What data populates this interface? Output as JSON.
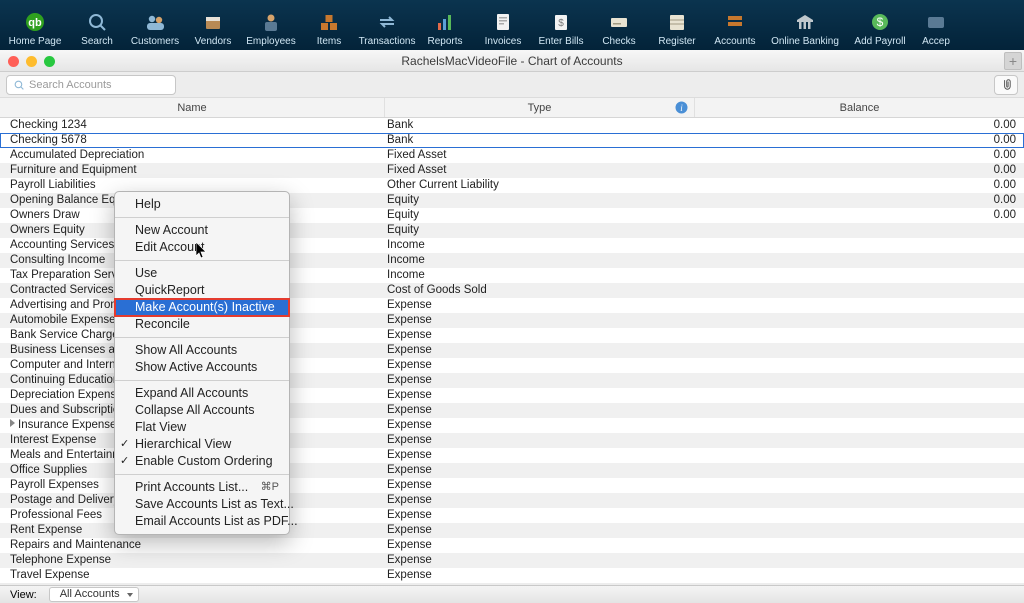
{
  "toolbar": [
    {
      "label": "Home Page",
      "icon": "qb"
    },
    {
      "label": "Search",
      "icon": "search"
    },
    {
      "label": "Customers",
      "icon": "customers"
    },
    {
      "label": "Vendors",
      "icon": "vendors"
    },
    {
      "label": "Employees",
      "icon": "employees"
    },
    {
      "label": "Items",
      "icon": "items"
    },
    {
      "label": "Transactions",
      "icon": "transactions"
    },
    {
      "label": "Reports",
      "icon": "reports"
    },
    {
      "label": "Invoices",
      "icon": "invoices"
    },
    {
      "label": "Enter Bills",
      "icon": "bills"
    },
    {
      "label": "Checks",
      "icon": "checks"
    },
    {
      "label": "Register",
      "icon": "register"
    },
    {
      "label": "Accounts",
      "icon": "accounts"
    },
    {
      "label": "Online Banking",
      "icon": "bank"
    },
    {
      "label": "Add Payroll",
      "icon": "payroll"
    },
    {
      "label": "Accep",
      "icon": "accept"
    }
  ],
  "window_title": "RachelsMacVideoFile - Chart of Accounts",
  "search_placeholder": "Search Accounts",
  "columns": {
    "name": "Name",
    "type": "Type",
    "balance": "Balance"
  },
  "accounts": [
    {
      "name": "Checking 1234",
      "type": "Bank",
      "balance": "0.00"
    },
    {
      "name": "Checking 5678",
      "type": "Bank",
      "balance": "0.00",
      "selected": true
    },
    {
      "name": "Accumulated Depreciation",
      "type": "Fixed Asset",
      "balance": "0.00"
    },
    {
      "name": "Furniture and Equipment",
      "type": "Fixed Asset",
      "balance": "0.00"
    },
    {
      "name": "Payroll Liabilities",
      "type": "Other Current Liability",
      "balance": "0.00"
    },
    {
      "name": "Opening Balance Equity",
      "type": "Equity",
      "balance": "0.00"
    },
    {
      "name": "Owners Draw",
      "type": "Equity",
      "balance": "0.00"
    },
    {
      "name": "Owners Equity",
      "type": "Equity",
      "balance": ""
    },
    {
      "name": "Accounting Services Income",
      "type": "Income",
      "balance": ""
    },
    {
      "name": "Consulting Income",
      "type": "Income",
      "balance": ""
    },
    {
      "name": "Tax Preparation Services",
      "type": "Income",
      "balance": ""
    },
    {
      "name": "Contracted Services",
      "type": "Cost of Goods Sold",
      "balance": ""
    },
    {
      "name": "Advertising and Promotion",
      "type": "Expense",
      "balance": ""
    },
    {
      "name": "Automobile Expense",
      "type": "Expense",
      "balance": ""
    },
    {
      "name": "Bank Service Charges",
      "type": "Expense",
      "balance": ""
    },
    {
      "name": "Business Licenses and Permits",
      "type": "Expense",
      "balance": ""
    },
    {
      "name": "Computer and Internet Expense",
      "type": "Expense",
      "balance": ""
    },
    {
      "name": "Continuing Education",
      "type": "Expense",
      "balance": ""
    },
    {
      "name": "Depreciation Expense",
      "type": "Expense",
      "balance": ""
    },
    {
      "name": "Dues and Subscriptions",
      "type": "Expense",
      "balance": ""
    },
    {
      "name": "Insurance Expense",
      "type": "Expense",
      "balance": "",
      "caret": true
    },
    {
      "name": "Interest Expense",
      "type": "Expense",
      "balance": ""
    },
    {
      "name": "Meals and Entertainment",
      "type": "Expense",
      "balance": ""
    },
    {
      "name": "Office Supplies",
      "type": "Expense",
      "balance": ""
    },
    {
      "name": "Payroll Expenses",
      "type": "Expense",
      "balance": ""
    },
    {
      "name": "Postage and Delivery",
      "type": "Expense",
      "balance": ""
    },
    {
      "name": "Professional Fees",
      "type": "Expense",
      "balance": ""
    },
    {
      "name": "Rent Expense",
      "type": "Expense",
      "balance": ""
    },
    {
      "name": "Repairs and Maintenance",
      "type": "Expense",
      "balance": ""
    },
    {
      "name": "Telephone Expense",
      "type": "Expense",
      "balance": ""
    },
    {
      "name": "Travel Expense",
      "type": "Expense",
      "balance": ""
    }
  ],
  "context_menu": [
    {
      "label": "Help"
    },
    {
      "sep": true
    },
    {
      "label": "New Account"
    },
    {
      "label": "Edit Account"
    },
    {
      "sep": true
    },
    {
      "label": "Use"
    },
    {
      "label": "QuickReport"
    },
    {
      "label": "Make Account(s) Inactive",
      "highlight": true,
      "redbox": true
    },
    {
      "label": "Reconcile"
    },
    {
      "sep": true
    },
    {
      "label": "Show All Accounts"
    },
    {
      "label": "Show Active Accounts"
    },
    {
      "sep": true
    },
    {
      "label": "Expand All Accounts"
    },
    {
      "label": "Collapse All Accounts"
    },
    {
      "label": "Flat View"
    },
    {
      "label": "Hierarchical View",
      "check": true
    },
    {
      "label": "Enable Custom Ordering",
      "check": true
    },
    {
      "sep": true
    },
    {
      "label": "Print Accounts List...",
      "shortcut": "⌘P"
    },
    {
      "label": "Save Accounts List as Text..."
    },
    {
      "label": "Email Accounts List as PDF..."
    }
  ],
  "footer": {
    "view_label": "View:",
    "dropdown": "All Accounts"
  }
}
